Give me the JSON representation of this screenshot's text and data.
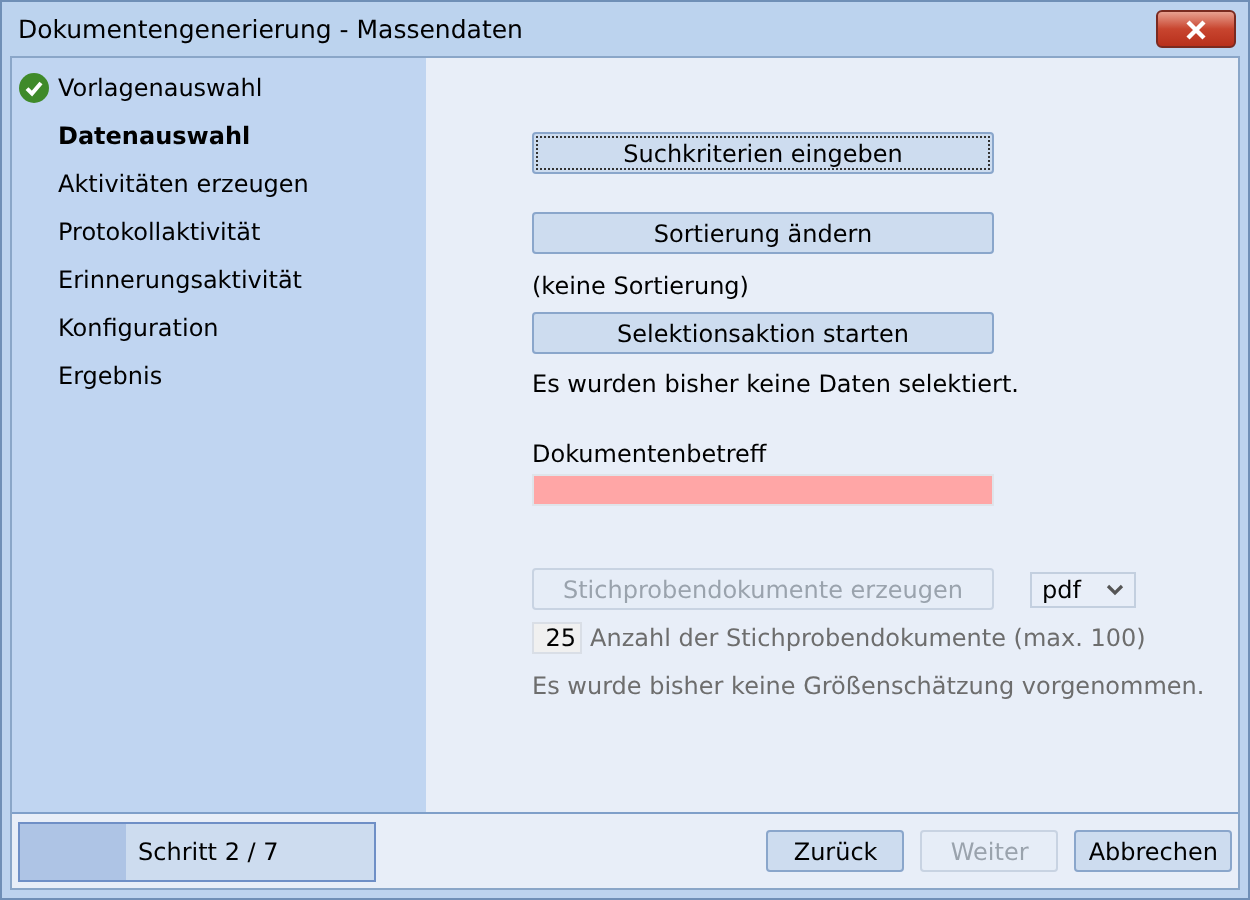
{
  "window": {
    "title": "Dokumentengenerierung - Massendaten"
  },
  "steps": [
    {
      "label": "Vorlagenauswahl",
      "done": true,
      "selected": false
    },
    {
      "label": "Datenauswahl",
      "done": false,
      "selected": true
    },
    {
      "label": "Aktivitäten erzeugen",
      "done": false,
      "selected": false
    },
    {
      "label": "Protokollaktivität",
      "done": false,
      "selected": false
    },
    {
      "label": "Erinnerungsaktivität",
      "done": false,
      "selected": false
    },
    {
      "label": "Konfiguration",
      "done": false,
      "selected": false
    },
    {
      "label": "Ergebnis",
      "done": false,
      "selected": false
    }
  ],
  "content": {
    "search_button": {
      "label": "Suchkriterien eingeben",
      "focused": true
    },
    "sort_button": {
      "label": "Sortierung ändern"
    },
    "sort_status": "(keine Sortierung)",
    "select_button": {
      "label": "Selektionsaktion starten"
    },
    "select_status": "Es wurden bisher keine Daten selektiert.",
    "subject_label": "Dokumentenbetreff",
    "subject_field": {
      "invalid": true
    },
    "sample_button": {
      "label": "Stichprobendokumente erzeugen",
      "disabled": true
    },
    "format_select": {
      "value": "pdf"
    },
    "sample_count": {
      "value": "25",
      "label": "Anzahl der Stichprobendokumente (max. 100)"
    },
    "estimate_status": "Es wurde bisher keine Größenschätzung vorgenommen."
  },
  "footer": {
    "progress": {
      "label": "Schritt 2 / 7",
      "level": 0.3
    },
    "buttons": [
      {
        "label": "Zurück",
        "disabled": false
      },
      {
        "label": "Weiter",
        "disabled": true
      },
      {
        "label": "Abbrechen",
        "disabled": false
      }
    ]
  }
}
